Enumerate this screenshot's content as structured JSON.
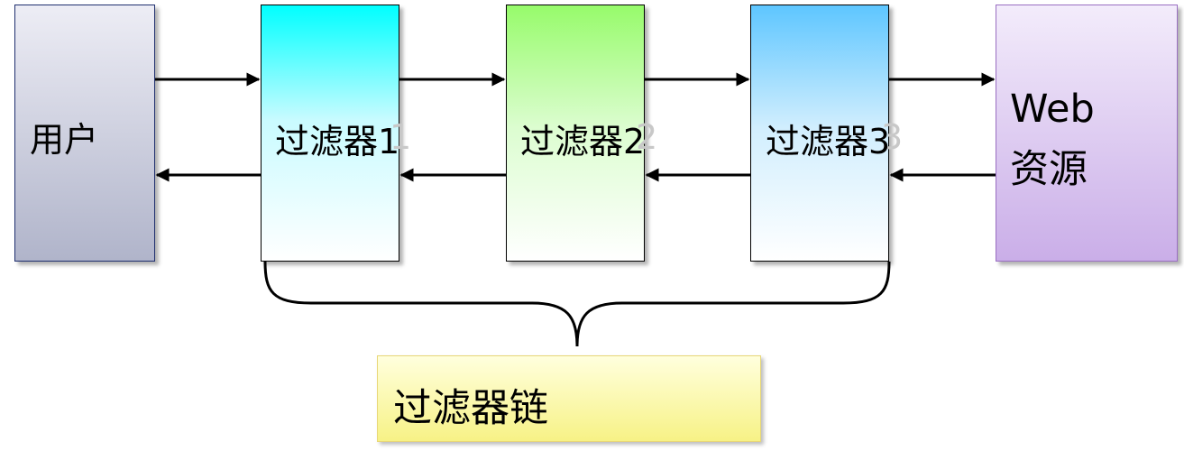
{
  "nodes": {
    "user": "用户",
    "filter1": "过滤器1",
    "filter2": "过滤器2",
    "filter3": "过滤器3",
    "web_line1": "Web",
    "web_line2": "资源",
    "chain": "过滤器链"
  },
  "ghost_digits": {
    "filter1": "1",
    "filter2": "2",
    "filter3": "3"
  },
  "colors": {
    "user_fill": "#b0b4ca",
    "filter1_fill": "#00ffff",
    "filter2_fill": "#97fb6b",
    "filter3_fill": "#5ec6ff",
    "web_fill": "#caaee8",
    "chain_fill": "#f7f286",
    "arrow": "#000000"
  }
}
